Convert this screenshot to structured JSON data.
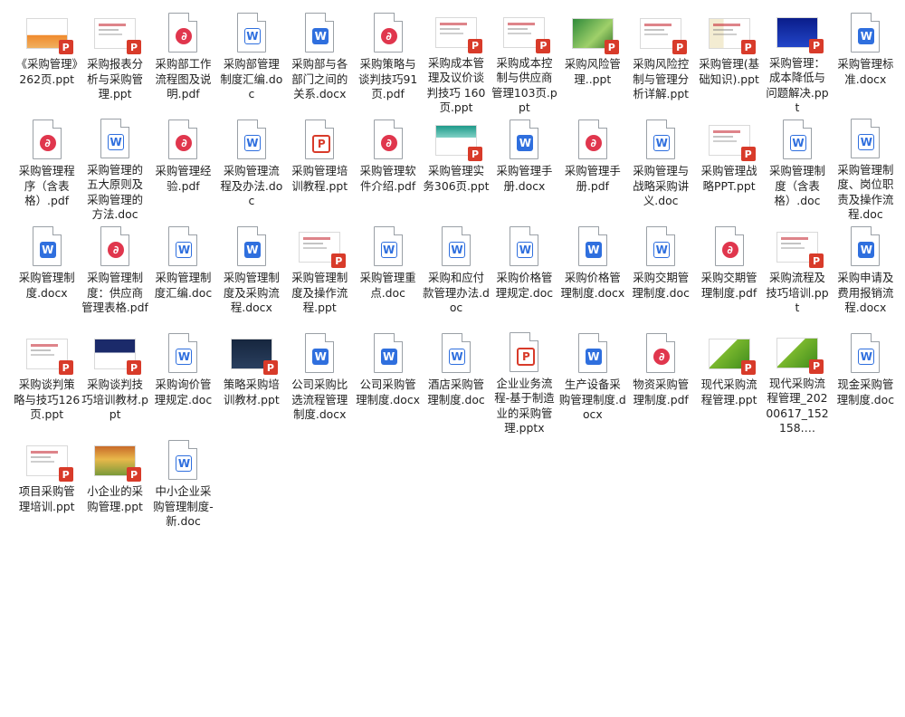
{
  "colors": {
    "pdf": "#e0364d",
    "docx": "#2f6fde",
    "ppt": "#d83b2a"
  },
  "files": [
    {
      "name": "《采购管理》262页.ppt",
      "kind": "ppt-thumb",
      "icon": "slide-orange"
    },
    {
      "name": "采购报表分析与采购管理.ppt",
      "kind": "ppt-thumb",
      "icon": "slide-white"
    },
    {
      "name": "采购部工作流程图及说明.pdf",
      "kind": "pdf"
    },
    {
      "name": "采购部管理制度汇编.doc",
      "kind": "doc"
    },
    {
      "name": "采购部与各部门之间的关系.docx",
      "kind": "docx"
    },
    {
      "name": "采购策略与谈判技巧91页.pdf",
      "kind": "pdf"
    },
    {
      "name": "采购成本管理及议价谈判技巧 160页.ppt",
      "kind": "ppt-thumb",
      "icon": "slide-table"
    },
    {
      "name": "采购成本控制与供应商管理103页.ppt",
      "kind": "ppt-thumb",
      "icon": "slide-list"
    },
    {
      "name": "采购风险管理..ppt",
      "kind": "ppt-thumb",
      "icon": "slide-green"
    },
    {
      "name": "采购风险控制与管理分析详解.ppt",
      "kind": "ppt-thumb",
      "icon": "slide-white"
    },
    {
      "name": "采购管理(基础知识).ppt",
      "kind": "ppt-thumb",
      "icon": "slide-cream"
    },
    {
      "name": "采购管理：成本降低与问题解决.ppt",
      "kind": "ppt-thumb",
      "icon": "slide-blue"
    },
    {
      "name": "采购管理标准.docx",
      "kind": "docx"
    },
    {
      "name": "采购管理程序（含表格）.pdf",
      "kind": "pdf"
    },
    {
      "name": "采购管理的五大原则及采购管理的方法.doc",
      "kind": "doc"
    },
    {
      "name": "采购管理经验.pdf",
      "kind": "pdf"
    },
    {
      "name": "采购管理流程及办法.doc",
      "kind": "doc"
    },
    {
      "name": "采购管理培训教程.ppt",
      "kind": "pptx"
    },
    {
      "name": "采购管理软件介绍.pdf",
      "kind": "pdf"
    },
    {
      "name": "采购管理实务306页.ppt",
      "kind": "ppt-thumb",
      "icon": "slide-teal"
    },
    {
      "name": "采购管理手册.docx",
      "kind": "docx"
    },
    {
      "name": "采购管理手册.pdf",
      "kind": "pdf"
    },
    {
      "name": "采购管理与战略采购讲义.doc",
      "kind": "doc"
    },
    {
      "name": "采购管理战略PPT.ppt",
      "kind": "ppt-thumb",
      "icon": "slide-white"
    },
    {
      "name": "采购管理制度（含表格）.doc",
      "kind": "doc"
    },
    {
      "name": "采购管理制度、岗位职责及操作流程.doc",
      "kind": "doc"
    },
    {
      "name": "采购管理制度.docx",
      "kind": "docx"
    },
    {
      "name": "采购管理制度：供应商管理表格.pdf",
      "kind": "pdf"
    },
    {
      "name": "采购管理制度汇编.doc",
      "kind": "doc"
    },
    {
      "name": "采购管理制度及采购流程.docx",
      "kind": "docx"
    },
    {
      "name": "采购管理制度及操作流程.ppt",
      "kind": "ppt-thumb",
      "icon": "slide-list"
    },
    {
      "name": "采购管理重点.doc",
      "kind": "doc"
    },
    {
      "name": "采购和应付款管理办法.doc",
      "kind": "doc"
    },
    {
      "name": "采购价格管理规定.doc",
      "kind": "doc"
    },
    {
      "name": "采购价格管理制度.docx",
      "kind": "docx"
    },
    {
      "name": "采购交期管理制度.doc",
      "kind": "doc"
    },
    {
      "name": "采购交期管理制度.pdf",
      "kind": "pdf"
    },
    {
      "name": "采购流程及技巧培训.ppt",
      "kind": "ppt-thumb",
      "icon": "slide-white"
    },
    {
      "name": "采购申请及费用报销流程.docx",
      "kind": "docx"
    },
    {
      "name": "采购谈判策略与技巧126页.ppt",
      "kind": "ppt-thumb",
      "icon": "slide-list"
    },
    {
      "name": "采购谈判技巧培训教材.ppt",
      "kind": "ppt-thumb",
      "icon": "slide-navy"
    },
    {
      "name": "采购询价管理规定.doc",
      "kind": "doc"
    },
    {
      "name": "策略采购培训教材.ppt",
      "kind": "ppt-thumb",
      "icon": "slide-dark"
    },
    {
      "name": "公司采购比选流程管理制度.docx",
      "kind": "docx"
    },
    {
      "name": "公司采购管理制度.docx",
      "kind": "docx"
    },
    {
      "name": "酒店采购管理制度.doc",
      "kind": "doc"
    },
    {
      "name": "企业业务流程-基于制造业的采购管理.pptx",
      "kind": "pptx"
    },
    {
      "name": "生产设备采购管理制度.docx",
      "kind": "docx"
    },
    {
      "name": "物资采购管理制度.pdf",
      "kind": "pdf"
    },
    {
      "name": "现代采购流程管理.ppt",
      "kind": "ppt-thumb",
      "icon": "slide-lime"
    },
    {
      "name": "现代采购流程管理_20200617_152158.…",
      "kind": "ppt-thumb",
      "icon": "slide-lime"
    },
    {
      "name": "现金采购管理制度.doc",
      "kind": "doc"
    },
    {
      "name": "项目采购管理培训.ppt",
      "kind": "ppt-thumb",
      "icon": "slide-white"
    },
    {
      "name": "小企业的采购管理.ppt",
      "kind": "ppt-thumb",
      "icon": "slide-photo"
    },
    {
      "name": "中小企业采购管理制度-新.doc",
      "kind": "doc"
    }
  ]
}
